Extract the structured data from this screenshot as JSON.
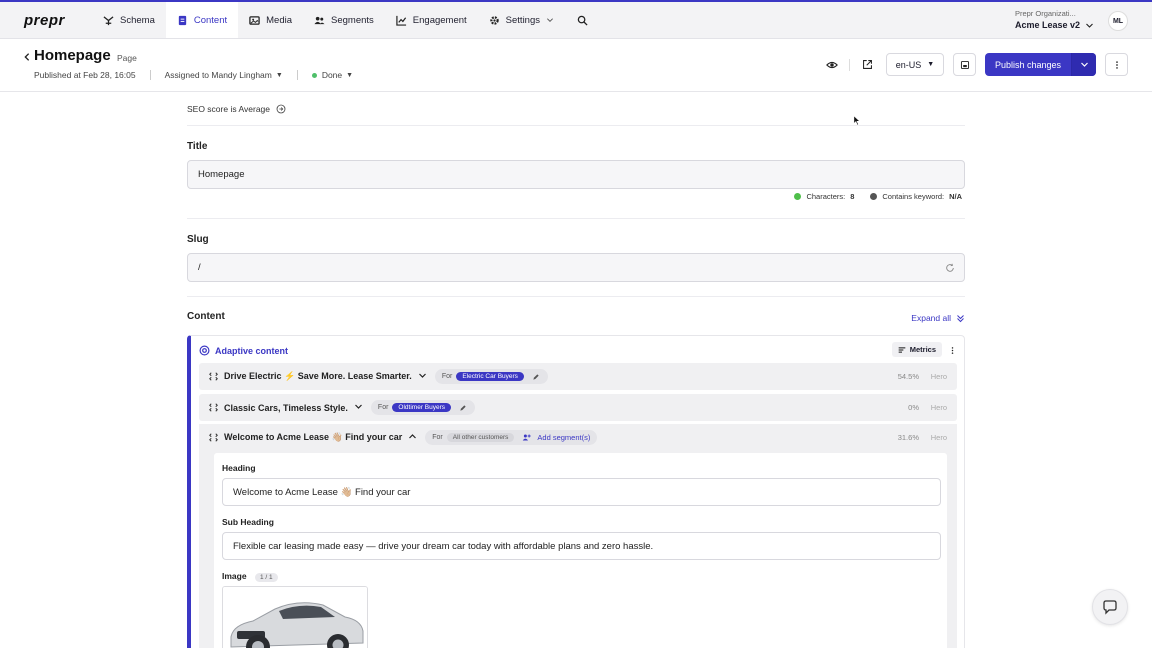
{
  "brand": {
    "logo": "prepr",
    "accent": "#3b37c4"
  },
  "nav": {
    "items": [
      {
        "label": "Schema",
        "icon": "schema-icon"
      },
      {
        "label": "Content",
        "icon": "content-icon",
        "active": true
      },
      {
        "label": "Media",
        "icon": "media-icon"
      },
      {
        "label": "Segments",
        "icon": "segments-icon"
      },
      {
        "label": "Engagement",
        "icon": "engagement-icon"
      },
      {
        "label": "Settings",
        "icon": "gear-icon"
      }
    ],
    "org_label": "Prepr Organizati...",
    "org_name": "Acme Lease v2",
    "avatar": "ML"
  },
  "header": {
    "title": "Homepage",
    "type": "Page",
    "published": "Published at Feb 28, 16:05",
    "assigned": "Assigned to Mandy Lingham",
    "status": "Done",
    "locale": "en-US",
    "publish_label": "Publish changes"
  },
  "form": {
    "seo": "SEO score is Average",
    "title_label": "Title",
    "title_value": "Homepage",
    "characters_label": "Characters:",
    "characters_value": "8",
    "keyword_label": "Contains keyword:",
    "keyword_value": "N/A",
    "slug_label": "Slug",
    "slug_value": "/",
    "content_label": "Content",
    "expand_all": "Expand all"
  },
  "adaptive": {
    "label": "Adaptive content",
    "metrics": "Metrics",
    "for_label": "For",
    "add_segment": "Add segment(s)",
    "variants": [
      {
        "title": "Drive Electric ⚡ Save More. Lease Smarter.",
        "segment": "Electric Car Buyers",
        "percent": "54.5%",
        "kind": "Hero"
      },
      {
        "title": "Classic Cars, Timeless Style.",
        "segment": "Oldtimer Buyers",
        "percent": "0%",
        "kind": "Hero"
      },
      {
        "title": "Welcome to Acme Lease 👋🏼 Find your car",
        "segment": "All other customers",
        "percent": "31.6%",
        "kind": "Hero"
      }
    ],
    "fields": {
      "heading_label": "Heading",
      "heading_value": "Welcome to Acme Lease 👋🏼 Find your car",
      "subheading_label": "Sub Heading",
      "subheading_value": "Flexible car leasing made easy — drive your dream car today with affordable plans and zero hassle.",
      "image_label": "Image",
      "image_count": "1 / 1"
    }
  }
}
